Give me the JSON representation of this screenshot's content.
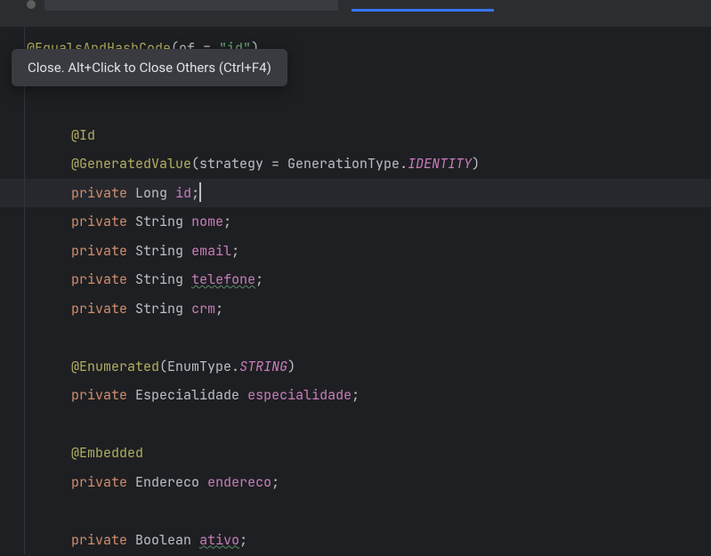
{
  "tooltip": {
    "text": "Close. Alt+Click to Close Others (Ctrl+F4)"
  },
  "code": {
    "line1": {
      "annotation": "@EqualsAndHashCode",
      "paren_open": "(",
      "param": "of = ",
      "string": "\"id\"",
      "paren_close": ")"
    },
    "line_id_ann": "@Id",
    "line_genvalue": {
      "annotation": "@GeneratedValue",
      "paren_open": "(",
      "param": "strategy = ",
      "type": "GenerationType",
      "dot": ".",
      "const": "IDENTITY",
      "paren_close": ")"
    },
    "line_id": {
      "modifier": "private",
      "type": "Long",
      "name": "id",
      "semi": ";"
    },
    "line_nome": {
      "modifier": "private",
      "type": "String",
      "name": "nome",
      "semi": ";"
    },
    "line_email": {
      "modifier": "private",
      "type": "String",
      "name": "email",
      "semi": ";"
    },
    "line_telefone": {
      "modifier": "private",
      "type": "String",
      "name": "telefone",
      "semi": ";"
    },
    "line_crm": {
      "modifier": "private",
      "type": "String",
      "name": "crm",
      "semi": ";"
    },
    "line_enum": {
      "annotation": "@Enumerated",
      "paren_open": "(",
      "type": "EnumType",
      "dot": ".",
      "const": "STRING",
      "paren_close": ")"
    },
    "line_espec": {
      "modifier": "private",
      "type": "Especialidade",
      "name": "especialidade",
      "semi": ";"
    },
    "line_embedded": "@Embedded",
    "line_endereco": {
      "modifier": "private",
      "type": "Endereco",
      "name": "endereco",
      "semi": ";"
    },
    "line_ativo": {
      "modifier": "private",
      "type": "Boolean",
      "name": "ativo",
      "semi": ";"
    }
  }
}
